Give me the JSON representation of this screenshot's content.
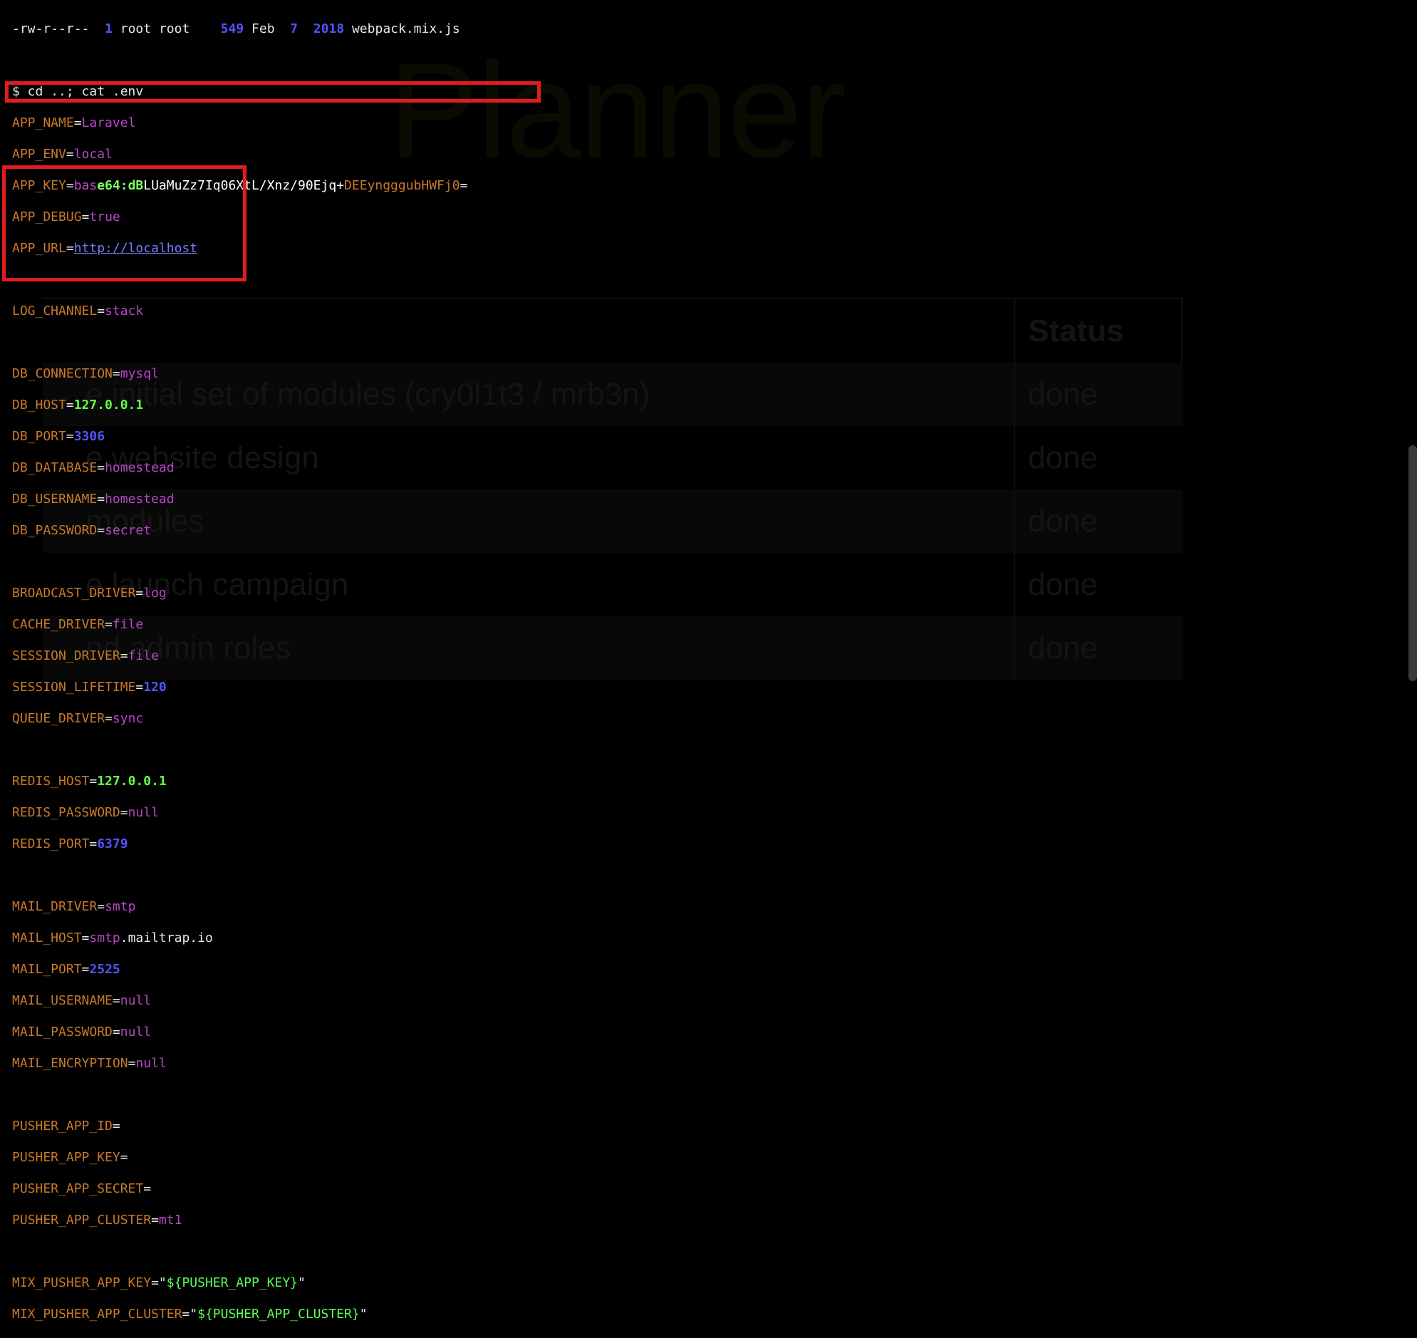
{
  "background": {
    "title": "Planner",
    "status_header": "Status",
    "rows": [
      {
        "task": "e initial set of modules (cry0l1t3 / mrb3n)",
        "status": "done"
      },
      {
        "task": "e website design",
        "status": "done"
      },
      {
        "task": "modules",
        "status": "done"
      },
      {
        "task": "e launch campaign",
        "status": "done"
      },
      {
        "task": "nd admin roles",
        "status": "done"
      }
    ]
  },
  "terminal": {
    "ls_line": {
      "perms": "-rw-r--r--",
      "links": "1",
      "owner": "root",
      "group": "root",
      "size": "549",
      "month": "Feb",
      "day": "7",
      "year": "2018",
      "file": "webpack.mix.js"
    },
    "prompt": "$ cd ..; cat .env",
    "app_key": {
      "key": "APP_KEY",
      "p1": "bas",
      "p2": "e64:dB",
      "p3": "LUaMuZz7Iq06XtL/Xnz/90Ejq+",
      "p4": "DEEyngggubHWFj0",
      "p5": "="
    },
    "env": {
      "APP_NAME": "Laravel",
      "APP_ENV": "local",
      "APP_DEBUG": "true",
      "APP_URL": "http://localhost",
      "LOG_CHANNEL": "stack",
      "DB_CONNECTION": "mysql",
      "DB_HOST": "127.0.0.1",
      "DB_PORT": "3306",
      "DB_DATABASE": "homestead",
      "DB_USERNAME": "homestead",
      "DB_PASSWORD": "secret",
      "BROADCAST_DRIVER": "log",
      "CACHE_DRIVER": "file",
      "SESSION_DRIVER": "file",
      "SESSION_LIFETIME": "120",
      "QUEUE_DRIVER": "sync",
      "REDIS_HOST": "127.0.0.1",
      "REDIS_PASSWORD": "null",
      "REDIS_PORT": "6379",
      "MAIL_DRIVER": "smtp",
      "MAIL_HOST_a": "smtp",
      "MAIL_HOST_b": ".mailtrap.io",
      "MAIL_PORT": "2525",
      "MAIL_USERNAME": "null",
      "MAIL_PASSWORD": "null",
      "MAIL_ENCRYPTION": "null",
      "PUSHER_APP_CLUSTER": "mt1",
      "MIX_PUSHER_APP_KEY": "${PUSHER_APP_KEY}",
      "MIX_PUSHER_APP_CLUSTER": "${PUSHER_APP_CLUSTER}"
    },
    "keys": {
      "APP_NAME": "APP_NAME",
      "APP_ENV": "APP_ENV",
      "APP_DEBUG": "APP_DEBUG",
      "APP_URL": "APP_URL",
      "LOG_CHANNEL": "LOG_CHANNEL",
      "DB_CONNECTION": "DB_CONNECTION",
      "DB_HOST": "DB_HOST",
      "DB_PORT": "DB_PORT",
      "DB_DATABASE": "DB_DATABASE",
      "DB_USERNAME": "DB_USERNAME",
      "DB_PASSWORD": "DB_PASSWORD",
      "BROADCAST_DRIVER": "BROADCAST_DRIVER",
      "CACHE_DRIVER": "CACHE_DRIVER",
      "SESSION_DRIVER": "SESSION_DRIVER",
      "SESSION_LIFETIME": "SESSION_LIFETIME",
      "QUEUE_DRIVER": "QUEUE_DRIVER",
      "REDIS_HOST": "REDIS_HOST",
      "REDIS_PASSWORD": "REDIS_PASSWORD",
      "REDIS_PORT": "REDIS_PORT",
      "MAIL_DRIVER": "MAIL_DRIVER",
      "MAIL_HOST": "MAIL_HOST",
      "MAIL_PORT": "MAIL_PORT",
      "MAIL_USERNAME": "MAIL_USERNAME",
      "MAIL_PASSWORD": "MAIL_PASSWORD",
      "MAIL_ENCRYPTION": "MAIL_ENCRYPTION",
      "PUSHER_APP_ID": "PUSHER_APP_ID",
      "PUSHER_APP_KEY": "PUSHER_APP_KEY",
      "PUSHER_APP_SECRET": "PUSHER_APP_SECRET",
      "PUSHER_APP_CLUSTER": "PUSHER_APP_CLUSTER",
      "MIX_PUSHER_APP_KEY": "MIX_PUSHER_APP_KEY",
      "MIX_PUSHER_APP_CLUSTER": "MIX_PUSHER_APP_CLUSTER"
    },
    "eq": "=",
    "quote": "\""
  },
  "colors": {
    "highlight": "#e01c1c",
    "key": "#c8782a",
    "string": "#b847c8",
    "number": "#5252ff",
    "ip": "#66ff44"
  }
}
